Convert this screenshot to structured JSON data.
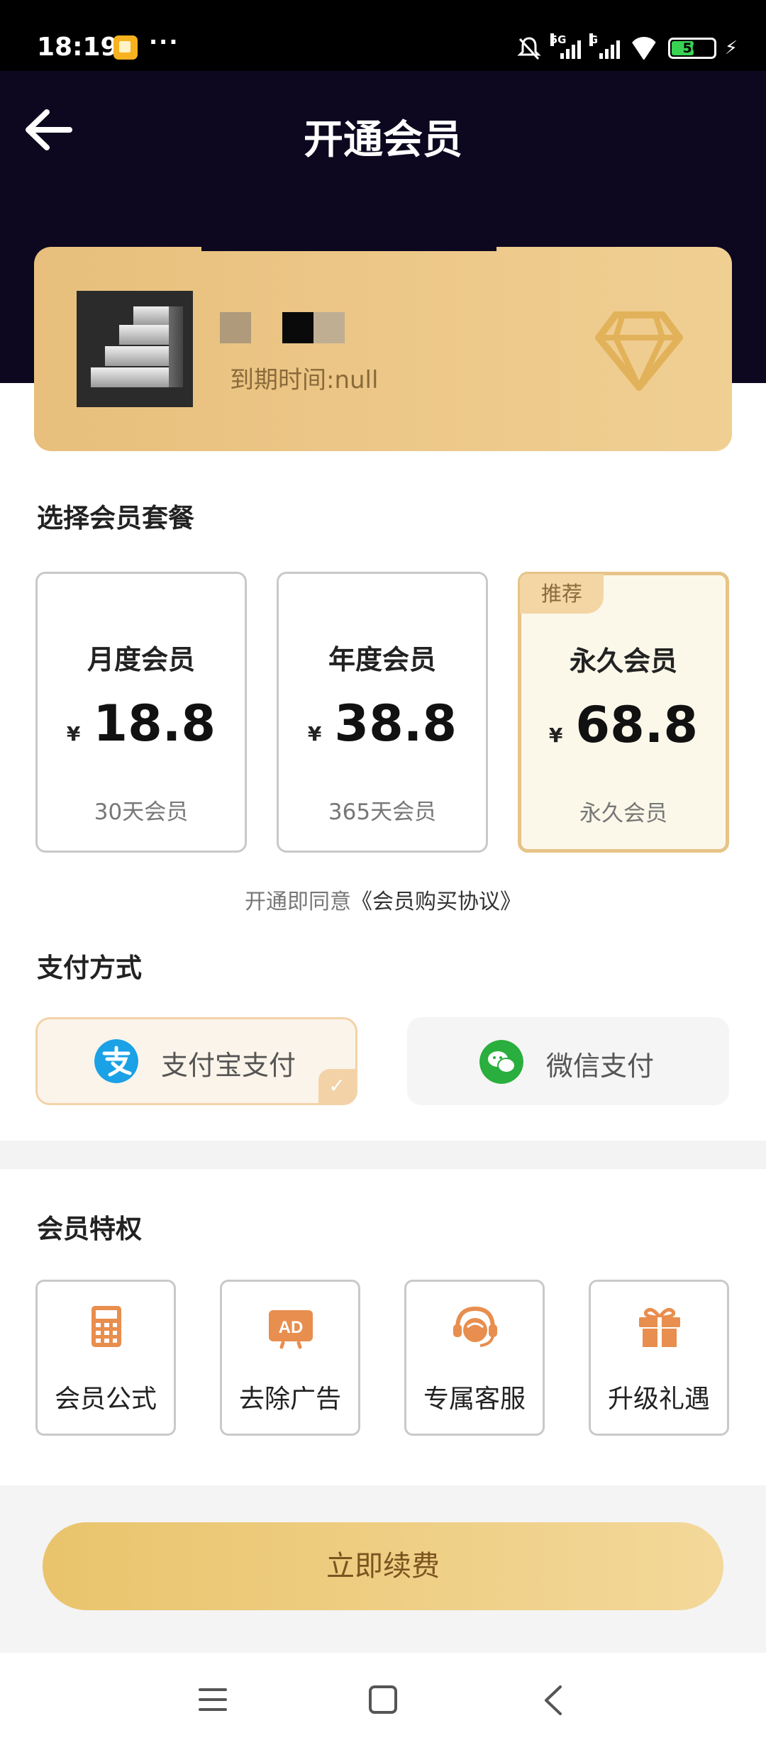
{
  "status_bar": {
    "time": "18:19",
    "more": "···",
    "signal1_label": "5G",
    "signal2_label": "G",
    "battery": "50"
  },
  "header": {
    "title": "开通会员"
  },
  "member_card": {
    "expire": "到期时间:null"
  },
  "plans": {
    "section_title": "选择会员套餐",
    "items": [
      {
        "name": "月度会员",
        "currency": "¥",
        "price": "18.8",
        "desc": "30天会员"
      },
      {
        "name": "年度会员",
        "currency": "¥",
        "price": "38.8",
        "desc": "365天会员"
      },
      {
        "name": "永久会员",
        "currency": "¥",
        "price": "68.8",
        "desc": "永久会员",
        "badge": "推荐",
        "selected": true
      }
    ]
  },
  "agreement": {
    "prefix": "开通即同意",
    "link": "《会员购买协议》"
  },
  "payment": {
    "section_title": "支付方式",
    "alipay": "支付宝支付",
    "wechat": "微信支付",
    "check": "✓",
    "selected": "alipay"
  },
  "privileges": {
    "section_title": "会员特权",
    "items": [
      {
        "label": "会员公式",
        "icon": "calculator-icon"
      },
      {
        "label": "去除广告",
        "icon": "ad-icon"
      },
      {
        "label": "专属客服",
        "icon": "customer-service-icon"
      },
      {
        "label": "升级礼遇",
        "icon": "gift-icon"
      }
    ]
  },
  "actions": {
    "renew": "立即续费"
  },
  "colors": {
    "header_bg": "#0d0820",
    "card_gold": "#ebc583",
    "accent": "#e88e4e",
    "button_gold": "#eccb7e"
  }
}
